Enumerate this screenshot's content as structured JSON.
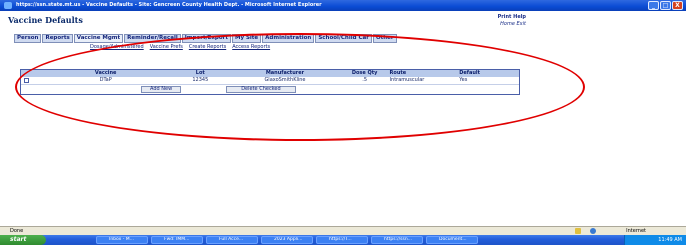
{
  "window": {
    "title": "https://ssn.state.mt.us - Vaccine Defaults - Site: Gencreen County Health Dept. - Microsoft Internet Explorer",
    "minimize": "_",
    "maximize": "□",
    "close": "X"
  },
  "app": {
    "title": "Vaccine Defaults",
    "print_help": "Print  Help",
    "home_exit": "Home  Exit"
  },
  "tabs": [
    "Person",
    "Reports",
    "Vaccine Mgmt",
    "Reminder/Recall",
    "Import/Export",
    "My Site",
    "Administration",
    "School/Child Car",
    "Other"
  ],
  "subtabs": [
    "Dosage/Administered",
    "Vaccine Prefs",
    "Create Reports",
    "Access Reports"
  ],
  "grid": {
    "headers": [
      "",
      "Vaccine",
      "Lot",
      "Manufacturer",
      "Dose Qty",
      "Route",
      "Default"
    ],
    "rows": [
      {
        "checked": false,
        "vaccine": "DTaP",
        "lot": "12345",
        "manufacturer": "GlaxoSmithKline",
        "dose_qty": ".5",
        "route": "Intramuscular",
        "default": "Yes"
      }
    ],
    "add_button": "Add New",
    "delete_button": "Delete Checked"
  },
  "statusbar": {
    "left": "Done",
    "zone": "Internet"
  },
  "taskbar": {
    "start": "start",
    "tasks": [
      "Inbox - M...",
      "Fwd: IMM...",
      "Full Acce...",
      "2023 Appli...",
      "https://T...",
      "https://ssn...",
      "Document..."
    ],
    "clock": "11:49 AM"
  },
  "colors": {
    "highlight_oval": "#e00000",
    "header_bg": "#b7c9ea",
    "accent_blue": "#13247a"
  }
}
